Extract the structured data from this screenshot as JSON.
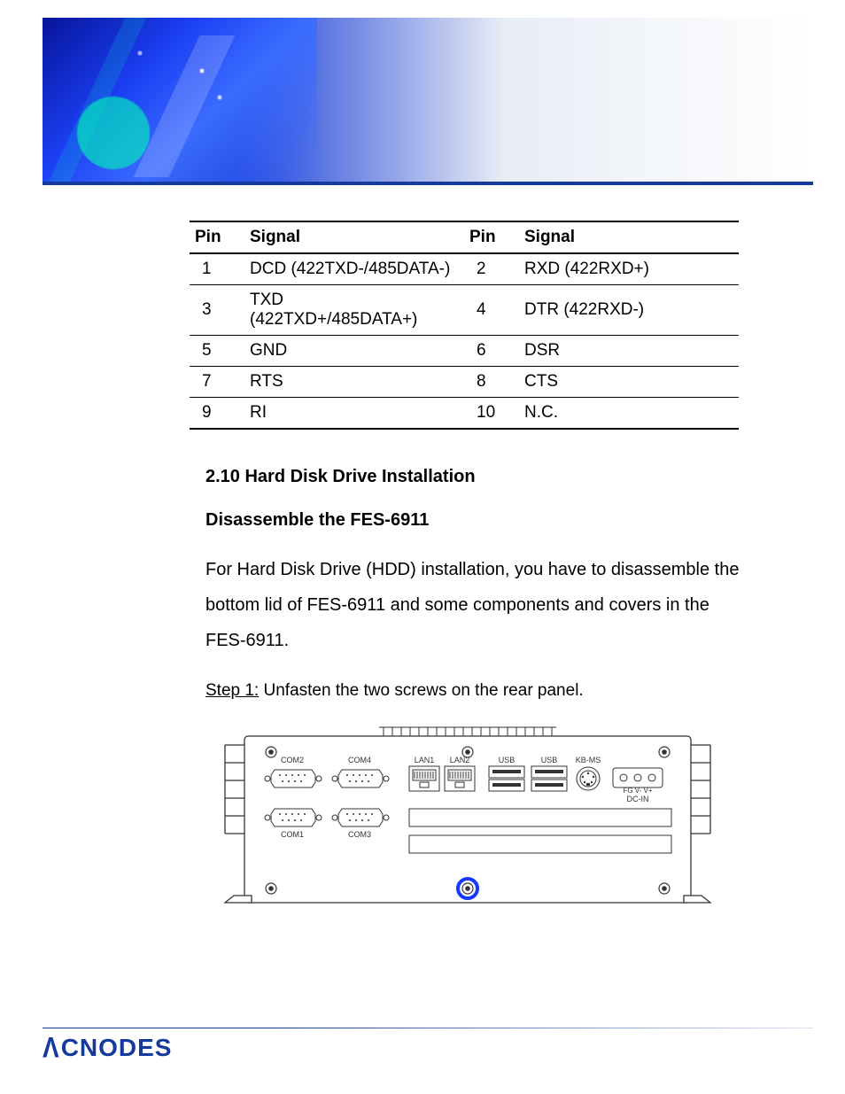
{
  "table": {
    "headers": {
      "pin": "Pin",
      "signal": "Signal"
    },
    "rows": [
      {
        "p1": "1",
        "s1": "DCD (422TXD-/485DATA-)",
        "p2": "2",
        "s2": "RXD (422RXD+)"
      },
      {
        "p1": "3",
        "s1": "TXD (422TXD+/485DATA+)",
        "p2": "4",
        "s2": "DTR (422RXD-)"
      },
      {
        "p1": "5",
        "s1": "GND",
        "p2": "6",
        "s2": "DSR"
      },
      {
        "p1": "7",
        "s1": "RTS",
        "p2": "8",
        "s2": "CTS"
      },
      {
        "p1": "9",
        "s1": "RI",
        "p2": "10",
        "s2": "N.C."
      }
    ]
  },
  "section": {
    "title": "2.10 Hard Disk Drive Installation",
    "subtitle": "Disassemble the FES-6911",
    "paragraph": "For Hard Disk Drive (HDD) installation, you have to disassemble the bottom lid of FES-6911 and some components and covers in the FES-6911."
  },
  "step": {
    "label": "Step 1:",
    "text": " Unfasten the two screws on the rear panel."
  },
  "diagram": {
    "ports": {
      "com1": "COM2",
      "com2": "COM4",
      "com3": "COM1",
      "com4": "COM3",
      "lan1": "LAN1",
      "lan2": "LAN2",
      "usb1": "USB",
      "usb2": "USB",
      "kbms": "KB-MS",
      "dcin": "DC-IN",
      "dcpins": "FG V- V+"
    }
  },
  "footer": {
    "brand": "CNODES"
  }
}
